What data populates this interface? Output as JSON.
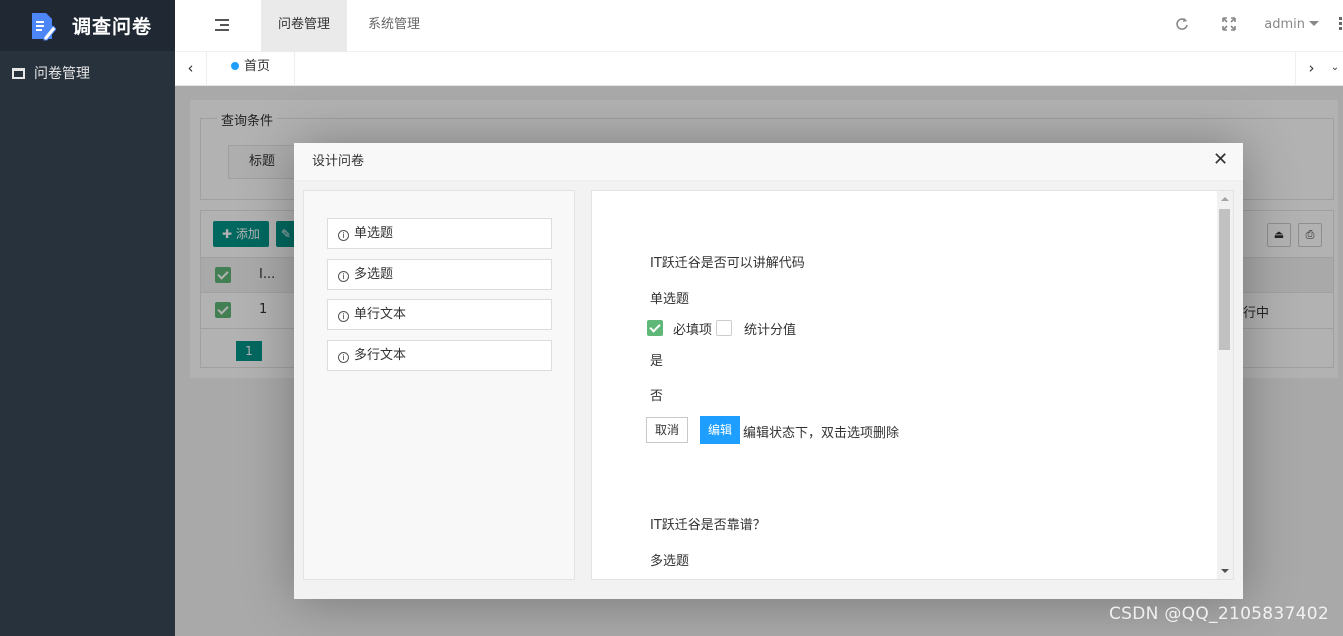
{
  "app": {
    "title": "调查问卷",
    "brand_color": "#4c86f7"
  },
  "sidebar": {
    "items": [
      {
        "label": "问卷管理",
        "icon": "window-icon"
      }
    ]
  },
  "header": {
    "tabs": [
      {
        "label": "问卷管理",
        "active": true
      },
      {
        "label": "系统管理",
        "active": false
      }
    ],
    "user": "admin",
    "icons": [
      "fold-menu-icon",
      "refresh-icon",
      "fullscreen-icon",
      "more-icon"
    ]
  },
  "tabbar": {
    "home_label": "首页"
  },
  "background": {
    "legend": "查询条件",
    "title_label": "标题",
    "add_button": "添加",
    "column_header": "I...",
    "row_value": "1",
    "status_partial": "行中",
    "page_number": "1",
    "accent": "#009688"
  },
  "modal": {
    "title": "设计问卷",
    "close_icon": "close-icon",
    "question_types": [
      {
        "label": "单选题"
      },
      {
        "label": "多选题"
      },
      {
        "label": "单行文本"
      },
      {
        "label": "多行文本"
      }
    ],
    "questions": [
      {
        "title": "IT跃迁谷是否可以讲解代码",
        "type": "单选题",
        "required_label": "必填项",
        "required_checked": true,
        "score_label": "统计分值",
        "score_checked": false,
        "options": [
          "是",
          "否"
        ],
        "cancel_label": "取消",
        "edit_label": "编辑",
        "hint": "编辑状态下，双击选项删除"
      },
      {
        "title": "IT跃迁谷是否靠谱？",
        "type": "多选题"
      }
    ]
  },
  "watermark": "CSDN @QQ_2105837402"
}
